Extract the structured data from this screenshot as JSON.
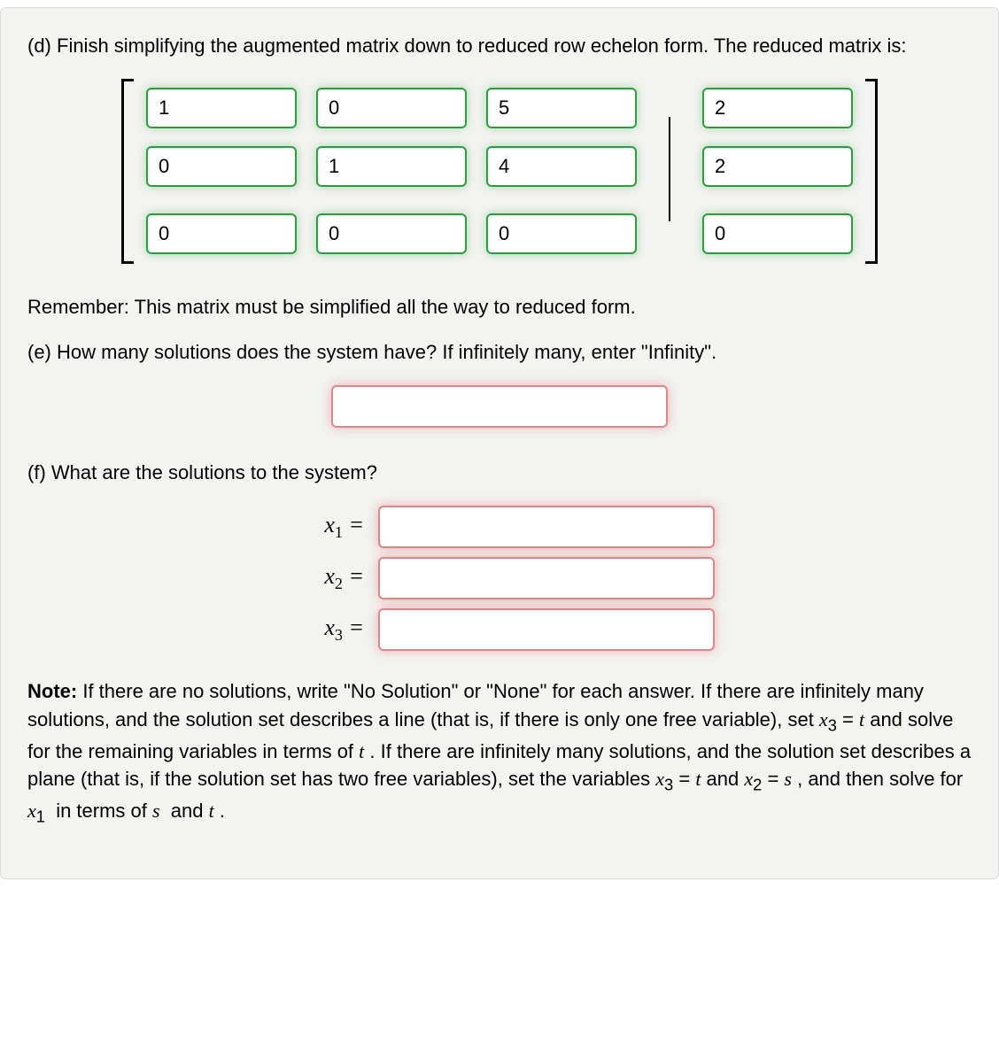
{
  "partD": {
    "prompt": "(d) Finish simplifying the augmented matrix down to reduced row echelon form. The reduced matrix is:",
    "matrix": {
      "leftRows": [
        [
          "1",
          "0",
          "5"
        ],
        [
          "0",
          "1",
          "4"
        ],
        [
          "0",
          "0",
          "0"
        ]
      ],
      "rightCol": [
        "2",
        "2",
        "0"
      ]
    },
    "reminder": "Remember: This matrix must be simplified all the way to reduced form."
  },
  "partE": {
    "prompt": "(e) How many solutions does the system have? If infinitely many, enter \"Infinity\".",
    "value": ""
  },
  "partF": {
    "prompt": "(f) What are the solutions to the system?",
    "rows": [
      {
        "label_html": "<span class=\"math\">x</span><sub>1</sub> =",
        "value": ""
      },
      {
        "label_html": "<span class=\"math\">x</span><sub>2</sub> =",
        "value": ""
      },
      {
        "label_html": "<span class=\"math\">x</span><sub>3</sub> =",
        "value": ""
      }
    ]
  },
  "note_html": "<b>Note:</b> If there are no solutions, write \"No Solution\" or \"None\" for each answer. If there are infinitely many solutions, and the solution set describes a line (that is, if there is only one free variable), set <span class=\"math\">x</span><sub>3</sub> = <span class=\"math\">t</span> and solve for the remaining variables in terms of <span class=\"math\">t</span> . If there are infinitely many solutions, and the solution set describes a plane (that is, if the solution set has two free variables), set the variables <span class=\"math\">x</span><sub>3</sub> = <span class=\"math\">t</span> and <span class=\"math\">x</span><sub>2</sub> = <span class=\"math\">s</span> , and then solve for <span class=\"math\">x</span><sub>1</sub>&nbsp; in terms of <span class=\"math\">s</span>&nbsp; and <span class=\"math\">t</span> ."
}
